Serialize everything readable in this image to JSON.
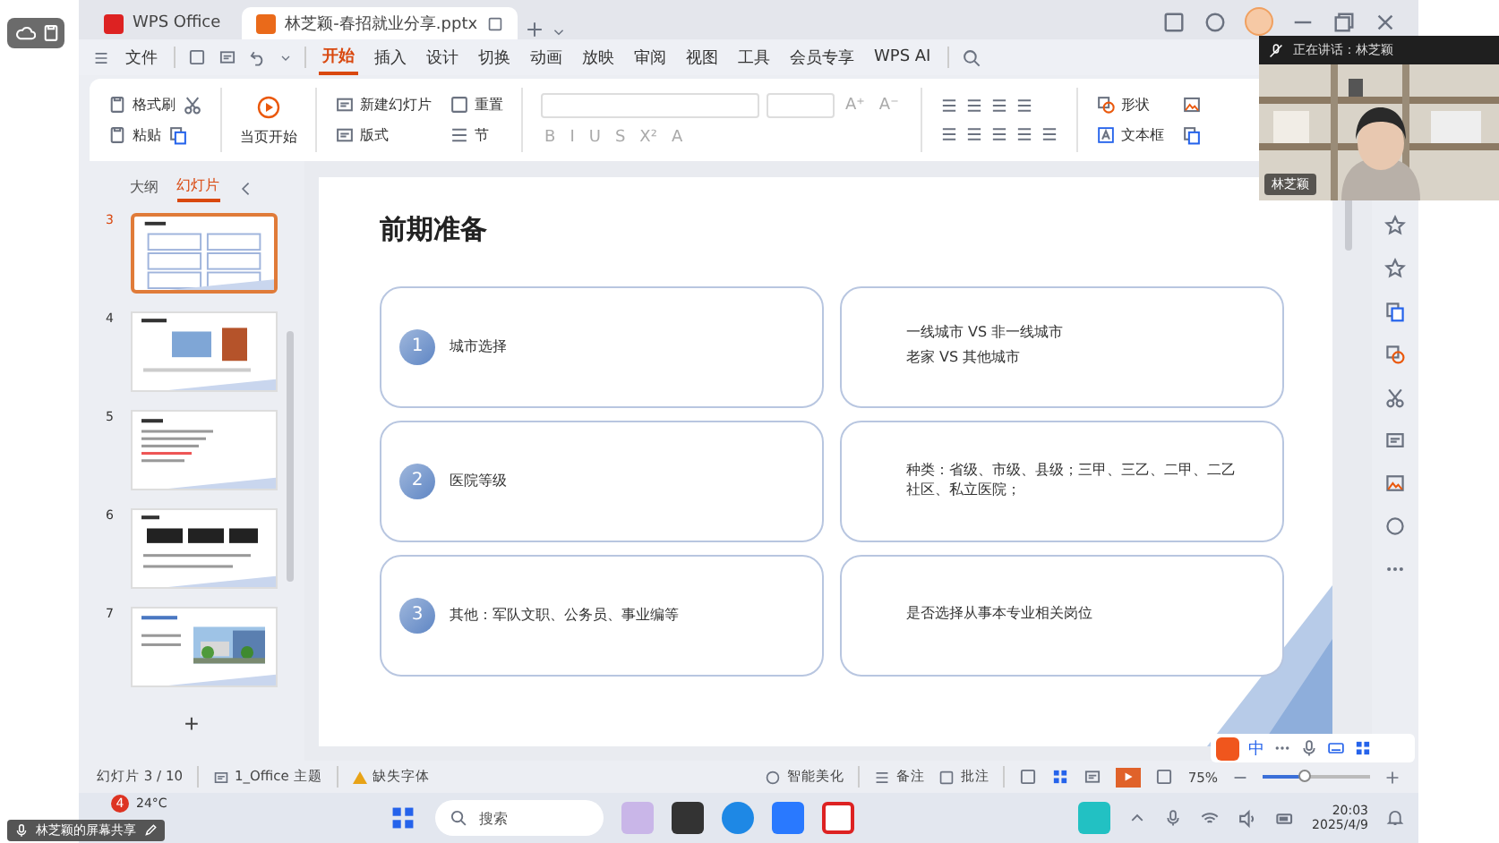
{
  "app_tabs": [
    {
      "label": "WPS Office",
      "selected": false,
      "kind": "home"
    },
    {
      "label": "林芝颖-春招就业分享.pptx",
      "selected": true,
      "kind": "doc"
    }
  ],
  "menu": {
    "file": "文件",
    "tabs": [
      {
        "label": "开始",
        "selected": true
      },
      {
        "label": "插入",
        "selected": false
      },
      {
        "label": "设计",
        "selected": false
      },
      {
        "label": "切换",
        "selected": false
      },
      {
        "label": "动画",
        "selected": false
      },
      {
        "label": "放映",
        "selected": false
      },
      {
        "label": "审阅",
        "selected": false
      },
      {
        "label": "视图",
        "selected": false
      },
      {
        "label": "工具",
        "selected": false
      },
      {
        "label": "会员专享",
        "selected": false
      },
      {
        "label": "WPS AI",
        "selected": false
      }
    ]
  },
  "ribbon": {
    "format_painter": "格式刷",
    "paste": "粘贴",
    "play_from_current": "当页开始",
    "new_slide": "新建幻灯片",
    "layout": "版式",
    "reset": "重置",
    "section": "节",
    "font_size_buttons": [
      "A⁺",
      "A⁻"
    ],
    "font_buttons": [
      "B",
      "I",
      "U",
      "S",
      "X²",
      "A"
    ],
    "shape": "形状",
    "text_box": "文本框"
  },
  "slide_panel": {
    "tabs": [
      {
        "label": "大纲",
        "selected": false
      },
      {
        "label": "幻灯片",
        "selected": true
      }
    ],
    "slides": [
      {
        "number": "3",
        "selected": true,
        "kind": "grid"
      },
      {
        "number": "4",
        "selected": false,
        "kind": "images"
      },
      {
        "number": "5",
        "selected": false,
        "kind": "text"
      },
      {
        "number": "6",
        "selected": false,
        "kind": "dark_images"
      },
      {
        "number": "7",
        "selected": false
      }
    ],
    "add": "+"
  },
  "slide": {
    "title": "前期准备",
    "rows": [
      {
        "number": "1",
        "label": "城市选择",
        "detail": [
          "一线城市 VS 非一线城市",
          "老家 VS 其他城市"
        ]
      },
      {
        "number": "2",
        "label": "医院等级",
        "detail": [
          "种类：省级、市级、县级；三甲、三乙、二甲、二乙社区、私立医院；"
        ]
      },
      {
        "number": "3",
        "label": "其他：军队文职、公务员、事业编等",
        "detail": [
          "是否选择从事本专业相关岗位"
        ]
      }
    ]
  },
  "video": {
    "speaking": "正在讲话：林芝颖",
    "name": "林芝颖"
  },
  "status_bar": {
    "slide_count": "幻灯片 3 / 10",
    "theme": "1_Office 主题",
    "missing_font": "缺失字体",
    "beautify": "智能美化",
    "notes": "备注",
    "comments": "批注",
    "zoom": "75%",
    "zoom_slider": {
      "level": 0.38
    }
  },
  "ime_bar": {
    "mode": "中"
  },
  "taskbar": {
    "weather": "24°C",
    "weather_badge": "4",
    "search": "搜索",
    "time": "20:03",
    "date": "2025/4/9"
  },
  "share_banner": "林芝颖的屏幕共享"
}
